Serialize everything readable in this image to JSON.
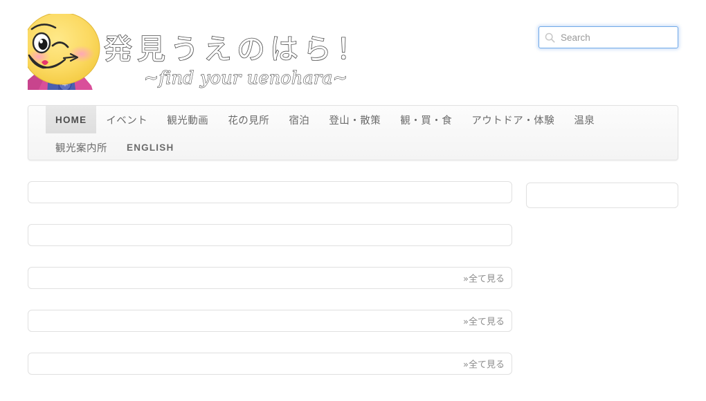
{
  "site": {
    "logo_title_jp": "発見うえのはら！",
    "logo_tagline_en": "~find your uenohara~",
    "logo_icon": "mascot-character-icon"
  },
  "search": {
    "placeholder": "Search",
    "value": "",
    "icon": "search-icon"
  },
  "nav": {
    "row1": [
      {
        "label": "HOME",
        "latin": true,
        "active": true
      },
      {
        "label": "イベント",
        "latin": false,
        "active": false
      },
      {
        "label": "観光動画",
        "latin": false,
        "active": false
      },
      {
        "label": "花の見所",
        "latin": false,
        "active": false
      },
      {
        "label": "宿泊",
        "latin": false,
        "active": false
      },
      {
        "label": "登山・散策",
        "latin": false,
        "active": false
      },
      {
        "label": "観・買・食",
        "latin": false,
        "active": false
      },
      {
        "label": "アウトドア・体験",
        "latin": false,
        "active": false
      },
      {
        "label": "温泉",
        "latin": false,
        "active": false
      }
    ],
    "row2": [
      {
        "label": "観光案内所",
        "latin": false,
        "active": false
      },
      {
        "label": "ENGLISH",
        "latin": true,
        "active": false
      }
    ]
  },
  "main": {
    "blocks": [
      {
        "name": "content-block-1",
        "more_label": ""
      },
      {
        "name": "content-block-2",
        "more_label": ""
      },
      {
        "name": "content-block-3",
        "more_label": "»全て見る"
      },
      {
        "name": "content-block-4",
        "more_label": "»全て見る"
      },
      {
        "name": "content-block-5",
        "more_label": "»全て見る"
      }
    ],
    "sidebar_block": {
      "name": "sidebar-block-1",
      "more_label": ""
    }
  },
  "colors": {
    "accent_border": "#e0e0e0",
    "search_focus": "#6ea8e8",
    "nav_bg": "#f4f4f4",
    "nav_active_bg": "#e2e2e2",
    "text_muted": "#8c8c8c"
  }
}
